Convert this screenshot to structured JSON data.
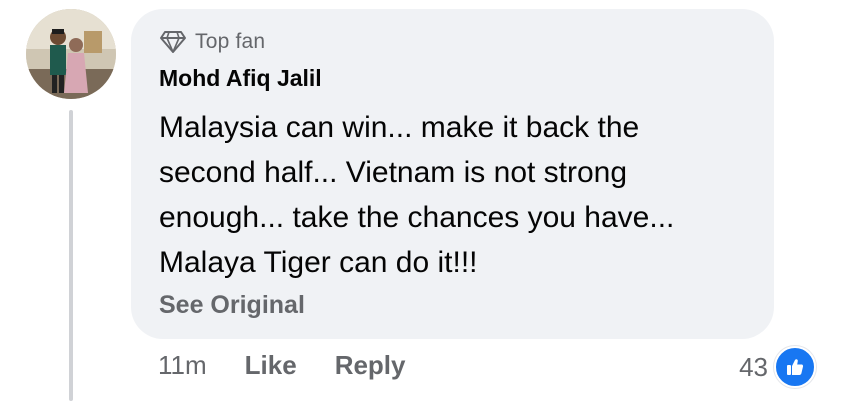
{
  "comment": {
    "badge": {
      "label": "Top fan",
      "icon": "diamond-icon"
    },
    "author": "Mohd Afiq Jalil",
    "text_lines": [
      "Malaysia can win... make it back the",
      "second half... Vietnam is not strong",
      "enough... take the chances you have...",
      "Malaya Tiger can do it!!!"
    ],
    "see_original": "See Original",
    "time": "11m",
    "like_label": "Like",
    "reply_label": "Reply",
    "reaction_count": "43",
    "reaction_icon": "thumbs-up-icon"
  },
  "colors": {
    "bubble": "#f0f2f5",
    "secondary_text": "#65676b",
    "primary_text": "#050505",
    "like_blue": "#1877f2"
  }
}
